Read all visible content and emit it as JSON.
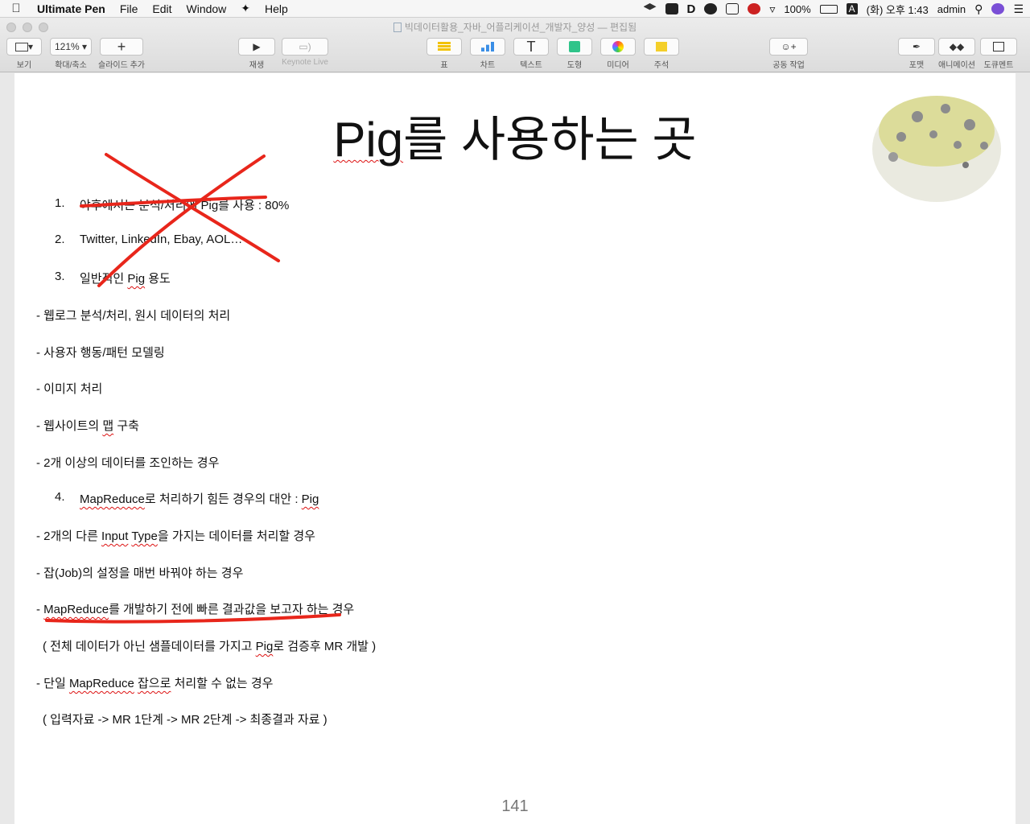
{
  "menubar": {
    "app_name": "Ultimate Pen",
    "items": [
      "File",
      "Edit",
      "Window",
      "Help"
    ],
    "battery": "100%",
    "input_method": "A",
    "clock": "(화) 오후 1:43",
    "user": "admin"
  },
  "window": {
    "doc_title": "빅데이터활용_자바_어플리케이션_개발자_양성 — 편집됨",
    "toolbar": {
      "view_label": "보기",
      "zoom_value": "121%",
      "zoom_label": "확대/축소",
      "add_slide_label": "슬라이드 추가",
      "play_label": "재생",
      "keynote_live_label": "Keynote Live",
      "table_label": "표",
      "chart_label": "차트",
      "text_label": "텍스트",
      "shape_label": "도형",
      "media_label": "미디어",
      "comment_label": "주석",
      "collaborate_label": "공동 작업",
      "format_label": "포맷",
      "animate_label": "애니메이션",
      "document_label": "도큐멘트"
    }
  },
  "slide": {
    "title_part1": "Pig",
    "title_part2": "를 사용하는 곳",
    "item1_num": "1.",
    "item1_text": "야후에서는 분석/처리에 Pig를 사용 : 80%",
    "item2_num": "2.",
    "item2_text": "Twitter, LinkedIn, Ebay, AOL…",
    "item3_num": "3.",
    "item3_text_a": "일반적인 ",
    "item3_text_b": "Pig",
    "item3_text_c": " 용도",
    "bullet1": "- 웹로그 분석/처리, 원시 데이터의 처리",
    "bullet2": "- 사용자 행동/패턴 모델링",
    "bullet3": "- 이미지 처리",
    "bullet4_a": "- 웹사이트의 ",
    "bullet4_b": "맵",
    "bullet4_c": " 구축",
    "bullet5": "- 2개 이상의 데이터를 조인하는 경우",
    "item4_num": "4.",
    "item4_a": "MapReduce",
    "item4_b": "로 처리하기 힘든 경우의 대안 : ",
    "item4_c": "Pig",
    "bullet6_a": "- 2개의 다른 ",
    "bullet6_b": "Input",
    "bullet6_c": " ",
    "bullet6_d": "Type",
    "bullet6_e": "을 가지는 데이터를 처리할 경우",
    "bullet7": "- 잡(Job)의 설정을 매번 바꿔야 하는 경우",
    "bullet8_a": "- ",
    "bullet8_b": "MapReduce",
    "bullet8_c": "를 개발하기 전에 빠른 결과값을 보고자 하는 경우",
    "bullet9_a": "( 전체 데이터가 아닌 샘플데이터를 가지고 ",
    "bullet9_b": "Pig",
    "bullet9_c": "로 검증후 MR 개발 )",
    "bullet10_a": "- 단일 ",
    "bullet10_b": "MapReduce",
    "bullet10_c": " ",
    "bullet10_d": "잡으로",
    "bullet10_e": " 처리할 수 없는 경우",
    "bullet11": "( 입력자료 -> MR 1단계 -> MR 2단계 -> 최종결과 자료 )",
    "page_number": "141"
  },
  "colors": {
    "ink_red": "#e8261b",
    "spell_red": "#d11111"
  }
}
